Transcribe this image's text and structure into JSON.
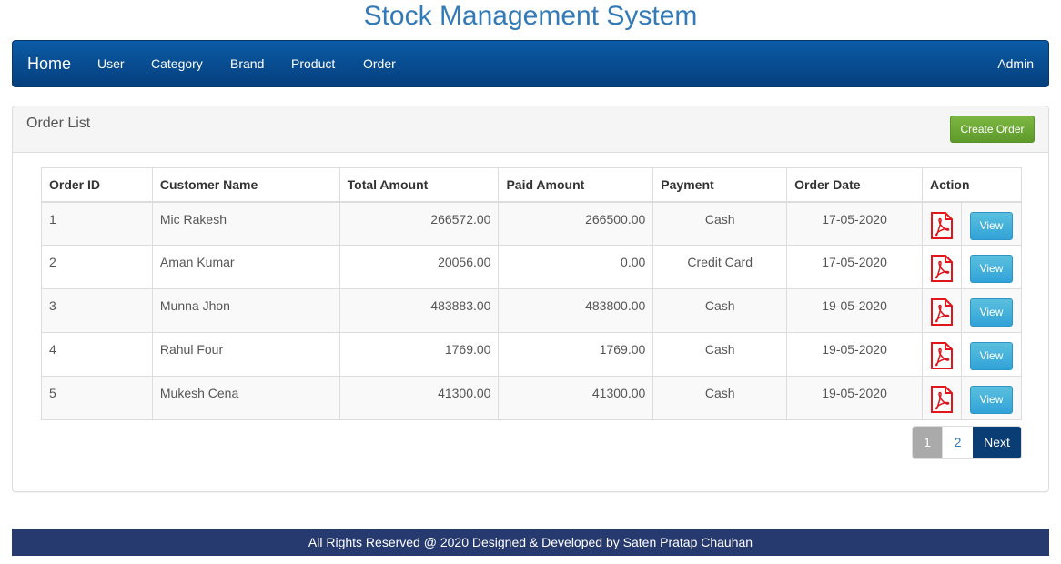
{
  "site": {
    "title": "Stock Management System"
  },
  "navbar": {
    "brand": "Home",
    "links": [
      "User",
      "Category",
      "Brand",
      "Product",
      "Order"
    ],
    "right": "Admin"
  },
  "panel": {
    "title": "Order List",
    "create_button": "Create Order"
  },
  "table": {
    "headers": [
      "Order ID",
      "Customer Name",
      "Total Amount",
      "Paid Amount",
      "Payment",
      "Order Date",
      "Action"
    ],
    "rows": [
      {
        "id": "1",
        "customer": "Mic Rakesh",
        "total": "266572.00",
        "paid": "266500.00",
        "payment": "Cash",
        "date": "17-05-2020",
        "view": "View"
      },
      {
        "id": "2",
        "customer": "Aman Kumar",
        "total": "20056.00",
        "paid": "0.00",
        "payment": "Credit Card",
        "date": "17-05-2020",
        "view": "View"
      },
      {
        "id": "3",
        "customer": "Munna Jhon",
        "total": "483883.00",
        "paid": "483800.00",
        "payment": "Cash",
        "date": "19-05-2020",
        "view": "View"
      },
      {
        "id": "4",
        "customer": "Rahul Four",
        "total": "1769.00",
        "paid": "1769.00",
        "payment": "Cash",
        "date": "19-05-2020",
        "view": "View"
      },
      {
        "id": "5",
        "customer": "Mukesh Cena",
        "total": "41300.00",
        "paid": "41300.00",
        "payment": "Cash",
        "date": "19-05-2020",
        "view": "View"
      }
    ],
    "row_icon": "pdf-icon"
  },
  "pagination": {
    "pages": [
      "1",
      "2"
    ],
    "current": "1",
    "next": "Next"
  },
  "footer": {
    "text": "All Rights Reserved @ 2020 Designed & Developed by Saten Pratap Chauhan"
  },
  "colors": {
    "title": "#337ab7",
    "navbar": "#053f7d",
    "create_button": "#5e9a2a",
    "view_button": "#31a2d8",
    "pdf_icon": "#e0161b",
    "footer": "#273a6f"
  }
}
